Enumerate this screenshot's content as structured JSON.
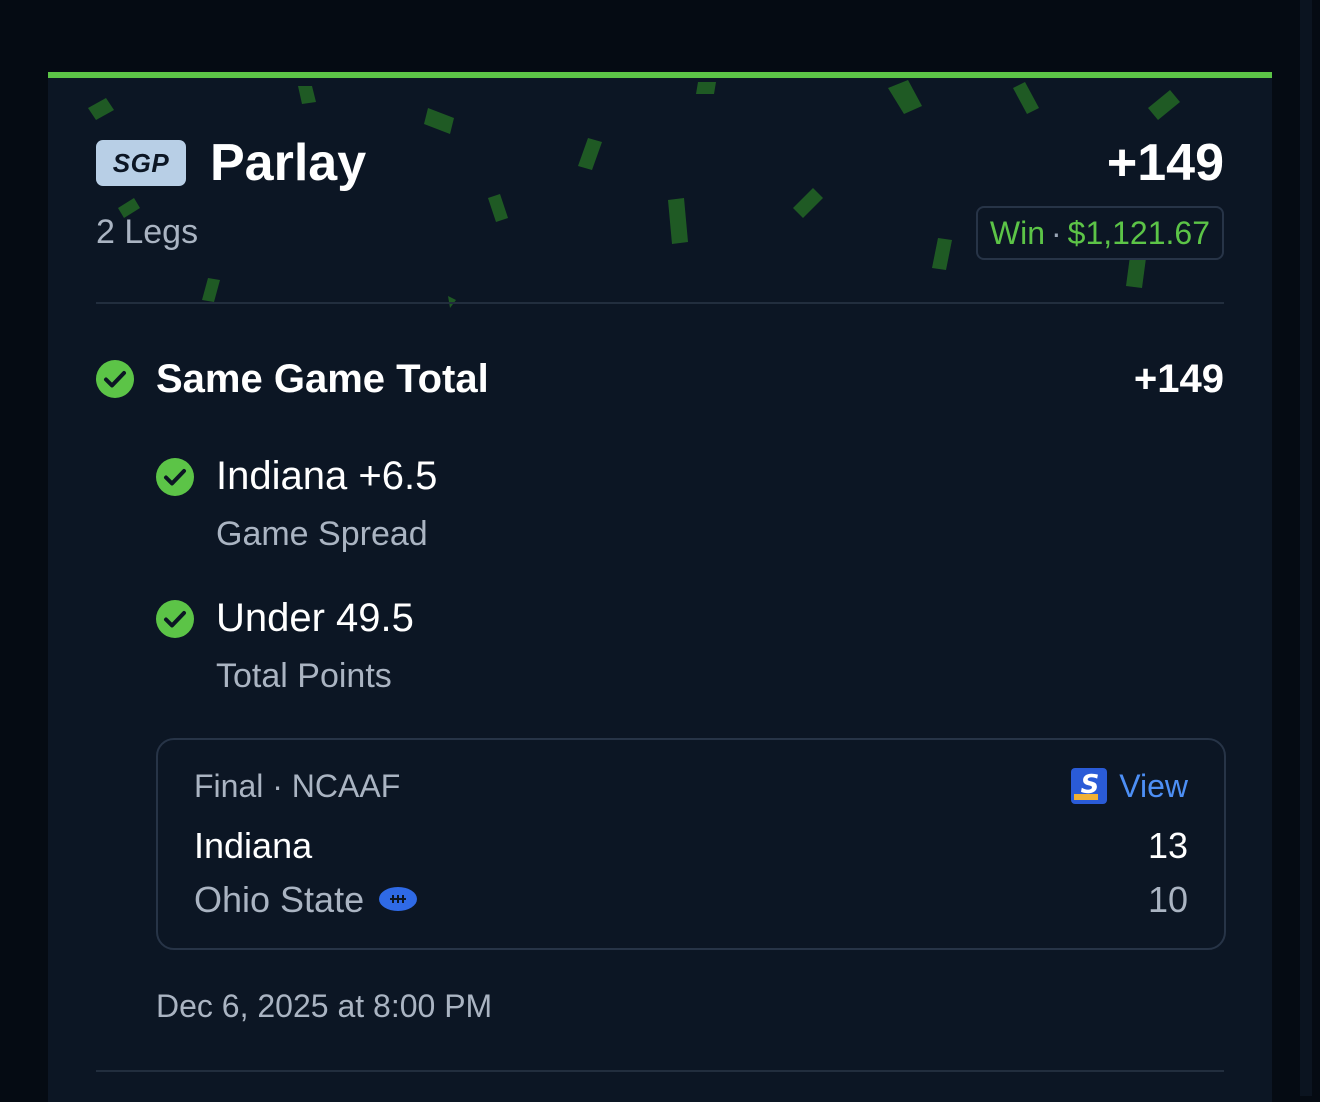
{
  "bet": {
    "badge": "SGP",
    "title": "Parlay",
    "odds": "+149",
    "legs_count": "2 Legs",
    "result": "Win",
    "separator": "·",
    "payout": "$1,121.67"
  },
  "group": {
    "title": "Same Game Total",
    "odds": "+149"
  },
  "legs": [
    {
      "selection": "Indiana +6.5",
      "market": "Game Spread"
    },
    {
      "selection": "Under 49.5",
      "market": "Total Points"
    }
  ],
  "game": {
    "status": "Final · NCAAF",
    "view_label": "View",
    "teams": [
      {
        "name": "Indiana",
        "score": "13"
      },
      {
        "name": "Ohio State",
        "score": "10"
      }
    ]
  },
  "placed_at": "Dec 6, 2025 at 8:00 PM",
  "colors": {
    "accent_green": "#5cc447",
    "link_blue": "#4d8ff5",
    "card_bg": "#0c1624",
    "badge_bg": "#b8cfe6"
  },
  "icons": {
    "check": "check-circle-icon",
    "score_provider": "score-app-logo-icon",
    "football": "football-icon"
  }
}
